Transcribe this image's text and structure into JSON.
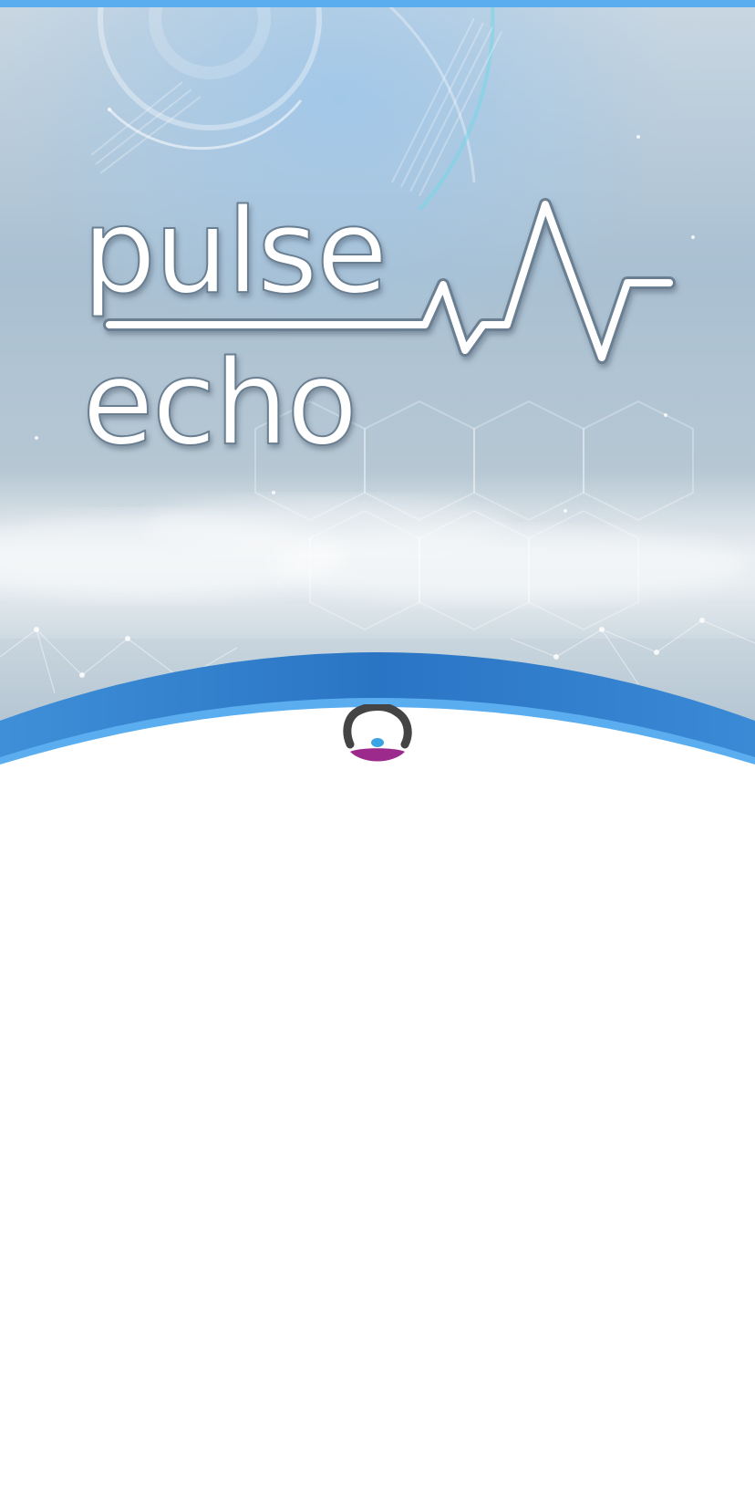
{
  "splash": {
    "logo_line_1": "pulse",
    "logo_line_2": "echo",
    "brand_mark_icon": "app-brand-mark-icon"
  },
  "colors": {
    "accent": "#5aaef0",
    "wave_blue": "#2f7fd0",
    "mark_dark": "#444444",
    "mark_purple": "#9b2a8c",
    "mark_dot": "#3aa3e3"
  }
}
